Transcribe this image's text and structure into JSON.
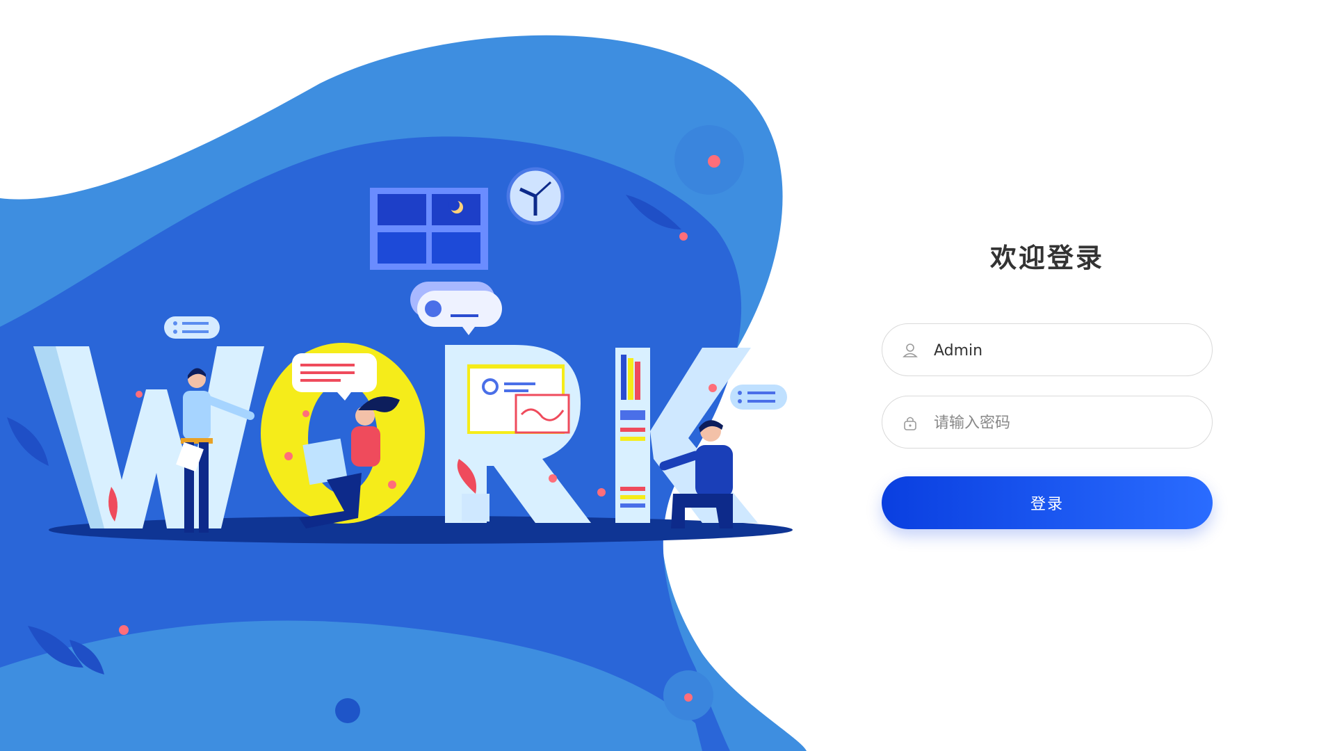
{
  "login": {
    "title": "欢迎登录",
    "username_value": "Admin",
    "password_placeholder": "请输入密码",
    "submit_label": "登录"
  },
  "illustration": {
    "letters": [
      "W",
      "O",
      "R",
      "K"
    ]
  },
  "colors": {
    "accent": "#1a5cf0",
    "blob_light": "#3e8ee0",
    "blob_dark": "#2a66d8"
  },
  "icons": {
    "username": "user-icon",
    "password": "lock-icon"
  }
}
